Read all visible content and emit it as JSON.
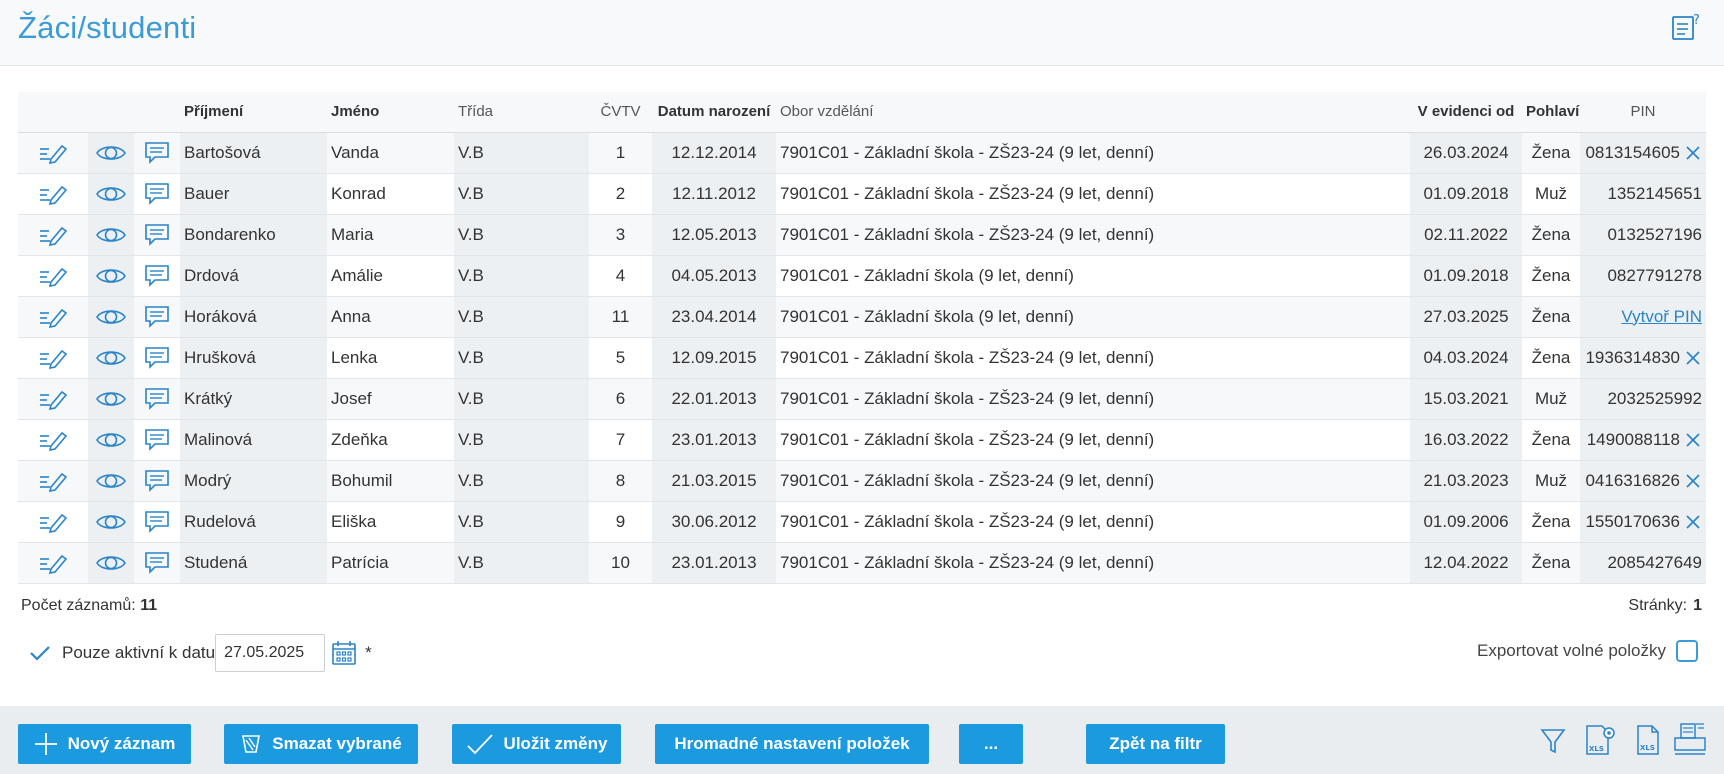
{
  "page": {
    "title": "Žáci/studenti"
  },
  "columns": {
    "surname": "Příjmení",
    "name": "Jméno",
    "class": "Třída",
    "cvtv": "ČVTV",
    "birth": "Datum narození",
    "field": "Obor vzdělání",
    "registered": "V evidenci od",
    "gender": "Pohlaví",
    "pin": "PIN"
  },
  "rows": [
    {
      "surname": "Bartošová",
      "name": "Vanda",
      "class": "V.B",
      "cvtv": "1",
      "birth": "12.12.2014",
      "field": "7901C01 - Základní škola - ZŠ23-24 (9 let, denní)",
      "registered": "26.03.2024",
      "gender": "Žena",
      "pin": "0813154605",
      "pin_clear": true
    },
    {
      "surname": "Bauer",
      "name": "Konrad",
      "class": "V.B",
      "cvtv": "2",
      "birth": "12.11.2012",
      "field": "7901C01 - Základní škola - ZŠ23-24 (9 let, denní)",
      "registered": "01.09.2018",
      "gender": "Muž",
      "pin": "1352145651",
      "pin_clear": false
    },
    {
      "surname": "Bondarenko",
      "name": "Maria",
      "class": "V.B",
      "cvtv": "3",
      "birth": "12.05.2013",
      "field": "7901C01 - Základní škola - ZŠ23-24 (9 let, denní)",
      "registered": "02.11.2022",
      "gender": "Žena",
      "pin": "0132527196",
      "pin_clear": false
    },
    {
      "surname": "Drdová",
      "name": "Amálie",
      "class": "V.B",
      "cvtv": "4",
      "birth": "04.05.2013",
      "field": "7901C01 - Základní škola (9 let, denní)",
      "registered": "01.09.2018",
      "gender": "Žena",
      "pin": "0827791278",
      "pin_clear": false
    },
    {
      "surname": "Horáková",
      "name": "Anna",
      "class": "V.B",
      "cvtv": "11",
      "birth": "23.04.2014",
      "field": "7901C01 - Základní škola (9 let, denní)",
      "registered": "27.03.2025",
      "gender": "Žena",
      "pin": "",
      "pin_link": "Vytvoř PIN",
      "pin_clear": false
    },
    {
      "surname": "Hrušková",
      "name": "Lenka",
      "class": "V.B",
      "cvtv": "5",
      "birth": "12.09.2015",
      "field": "7901C01 - Základní škola - ZŠ23-24 (9 let, denní)",
      "registered": "04.03.2024",
      "gender": "Žena",
      "pin": "1936314830",
      "pin_clear": true
    },
    {
      "surname": "Krátký",
      "name": "Josef",
      "class": "V.B",
      "cvtv": "6",
      "birth": "22.01.2013",
      "field": "7901C01 - Základní škola - ZŠ23-24 (9 let, denní)",
      "registered": "15.03.2021",
      "gender": "Muž",
      "pin": "2032525992",
      "pin_clear": false
    },
    {
      "surname": "Malinová",
      "name": "Zdeňka",
      "class": "V.B",
      "cvtv": "7",
      "birth": "23.01.2013",
      "field": "7901C01 - Základní škola - ZŠ23-24 (9 let, denní)",
      "registered": "16.03.2022",
      "gender": "Žena",
      "pin": "1490088118",
      "pin_clear": true
    },
    {
      "surname": "Modrý",
      "name": "Bohumil",
      "class": "V.B",
      "cvtv": "8",
      "birth": "21.03.2015",
      "field": "7901C01 - Základní škola - ZŠ23-24 (9 let, denní)",
      "registered": "21.03.2023",
      "gender": "Muž",
      "pin": "0416316826",
      "pin_clear": true
    },
    {
      "surname": "Rudelová",
      "name": "Eliška",
      "class": "V.B",
      "cvtv": "9",
      "birth": "30.06.2012",
      "field": "7901C01 - Základní škola - ZŠ23-24 (9 let, denní)",
      "registered": "01.09.2006",
      "gender": "Žena",
      "pin": "1550170636",
      "pin_clear": true
    },
    {
      "surname": "Studená",
      "name": "Patrícia",
      "class": "V.B",
      "cvtv": "10",
      "birth": "23.01.2013",
      "field": "7901C01 - Základní škola - ZŠ23-24 (9 let, denní)",
      "registered": "12.04.2022",
      "gender": "Žena",
      "pin": "2085427649",
      "pin_clear": false
    }
  ],
  "summary": {
    "count_label": "Počet záznamů:",
    "count_value": "11",
    "pages_label": "Stránky:",
    "pages_value": "1"
  },
  "filter": {
    "active_label": "Pouze aktivní k datu",
    "date_value": "27.05.2025",
    "asterisk": "*",
    "export_label": "Exportovat volné položky"
  },
  "buttons": {
    "new": "Nový záznam",
    "delete": "Smazat vybrané",
    "save": "Uložit změny",
    "bulk": "Hromadné nastavení položek",
    "more": "...",
    "back": "Zpět na filtr"
  },
  "icons": {
    "help": "help-document-icon",
    "edit": "pencil-icon",
    "view": "eye-icon",
    "message": "message-icon",
    "clear": "close-icon",
    "calendar": "calendar-icon",
    "filter": "filter-icon",
    "xls_settings": "xls-settings-icon",
    "xls": "xls-icon",
    "print": "print-icon"
  },
  "colors": {
    "accent": "#1c9ae0",
    "title": "#3c9bd6",
    "link": "#2a84c8"
  }
}
